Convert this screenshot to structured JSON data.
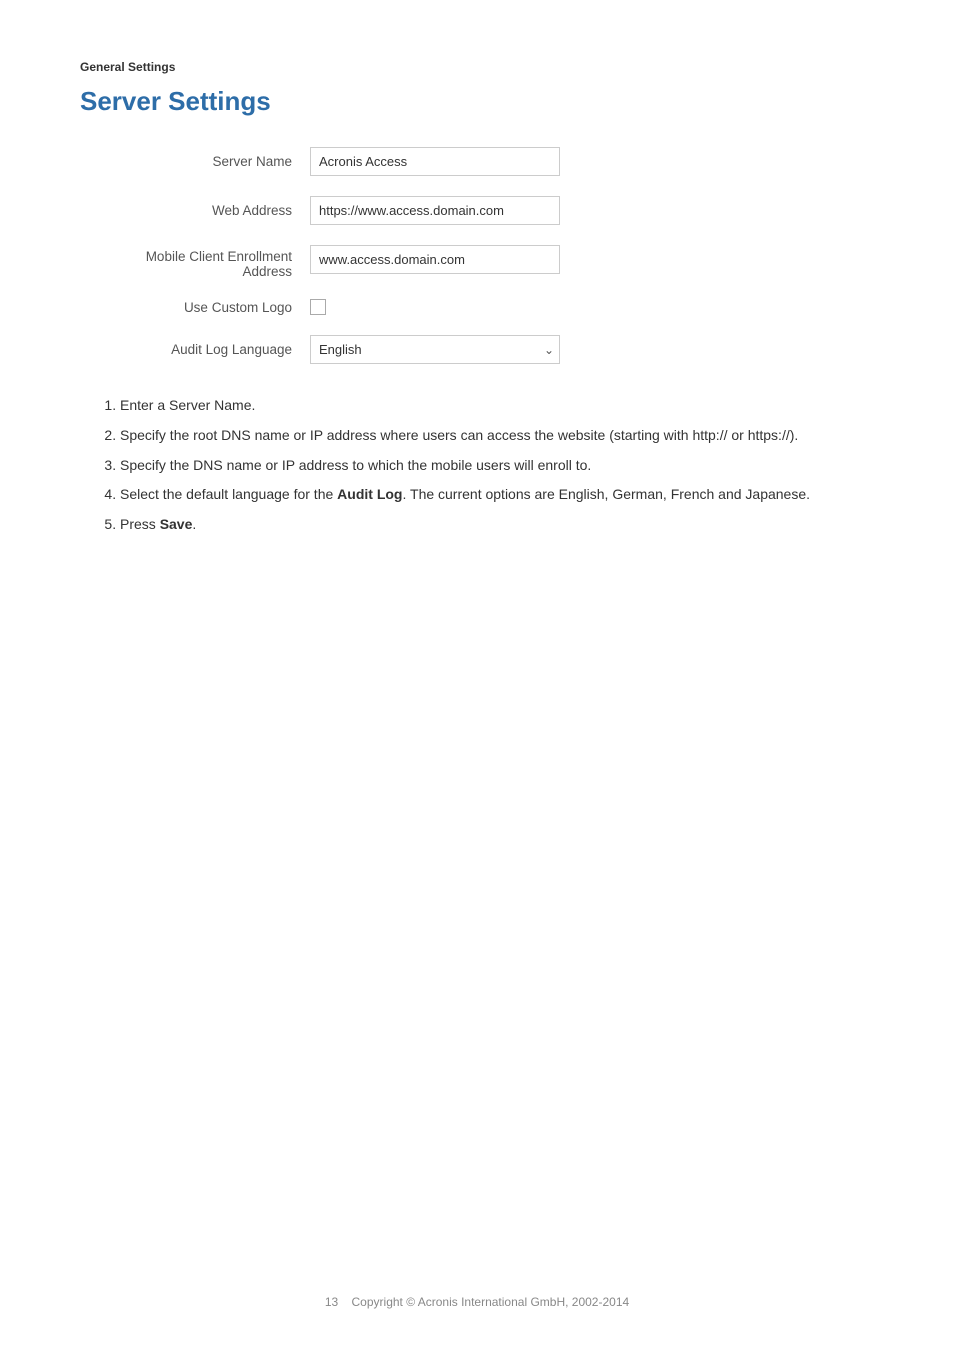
{
  "breadcrumb": {
    "label": "General Settings"
  },
  "page": {
    "title": "Server Settings"
  },
  "form": {
    "fields": [
      {
        "label": "Server Name",
        "type": "text",
        "value": "Acronis Access",
        "name": "server-name-input"
      },
      {
        "label": "Web Address",
        "type": "text",
        "value": "https://www.access.domain.com",
        "name": "web-address-input"
      },
      {
        "label_line1": "Mobile Client Enrollment",
        "label_line2": "Address",
        "type": "text",
        "value": "www.access.domain.com",
        "name": "mobile-client-enrollment-input"
      },
      {
        "label": "Use Custom Logo",
        "type": "checkbox",
        "checked": false,
        "name": "use-custom-logo-checkbox"
      },
      {
        "label": "Audit Log Language",
        "type": "select",
        "value": "English",
        "options": [
          "English",
          "German",
          "French",
          "Japanese"
        ],
        "name": "audit-log-language-select"
      }
    ]
  },
  "instructions": {
    "items": [
      {
        "text": "Enter a Server Name.",
        "bold_parts": []
      },
      {
        "text": "Specify the root DNS name or IP address where users can access the website (starting with http:// or https://).",
        "bold_parts": []
      },
      {
        "text": "Specify the DNS name or IP address to which the mobile users will enroll to.",
        "bold_parts": []
      },
      {
        "text": "Select the default language for the Audit Log. The current options are English, German, French and Japanese.",
        "bold_word": "Audit Log"
      },
      {
        "text": "Press Save.",
        "bold_word": "Save"
      }
    ]
  },
  "footer": {
    "page_number": "13",
    "copyright": "Copyright © Acronis International GmbH, 2002-2014"
  }
}
